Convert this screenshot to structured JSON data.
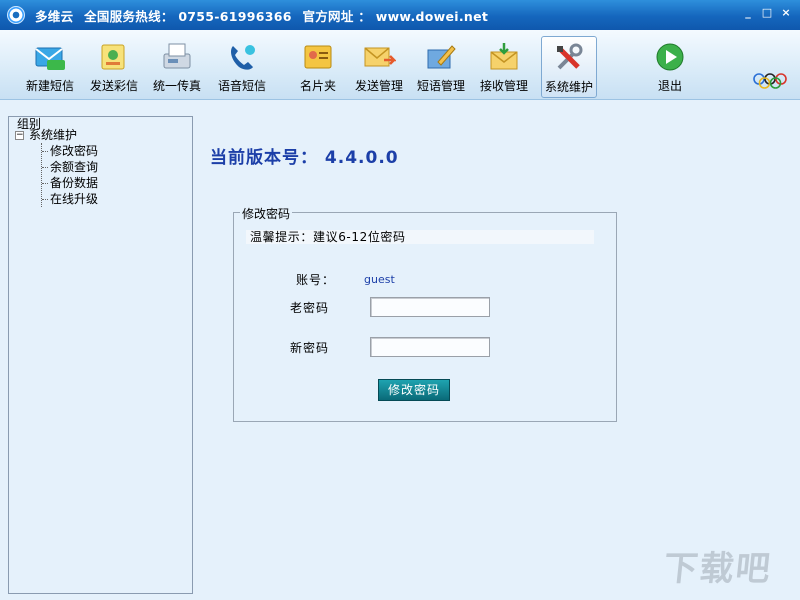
{
  "window": {
    "app_name": "多维云",
    "hotline": "全国服务热线： 0755-61996366",
    "website": "官方网址 ： www.dowei.net",
    "controls": {
      "minimize": "_",
      "maximize": "□",
      "close": "×"
    }
  },
  "toolbar": {
    "items": [
      {
        "label": "新建短信",
        "icon": "new-sms-icon"
      },
      {
        "label": "发送彩信",
        "icon": "send-mms-icon"
      },
      {
        "label": "统一传真",
        "icon": "fax-icon"
      },
      {
        "label": "语音短信",
        "icon": "voice-phone-icon"
      },
      {
        "label": "名片夹",
        "icon": "business-card-icon"
      },
      {
        "label": "发送管理",
        "icon": "send-mail-icon"
      },
      {
        "label": "短语管理",
        "icon": "phrase-edit-icon"
      },
      {
        "label": "接收管理",
        "icon": "receive-mail-icon"
      },
      {
        "label": "系统维护",
        "icon": "tools-icon"
      },
      {
        "label": "退出",
        "icon": "exit-icon"
      }
    ],
    "active": "系统维护"
  },
  "sidebar": {
    "group_label": "组别",
    "root": "系统维护",
    "children": [
      "修改密码",
      "余额查询",
      "备份数据",
      "在线升级"
    ]
  },
  "main": {
    "version_label": "当前版本号：",
    "version_value": "4.4.0.0",
    "form": {
      "legend": "修改密码",
      "tip": "温馨提示：建议6-12位密码",
      "account_label": "账号：",
      "account_value": "guest",
      "old_password_label": "老密码",
      "old_password_value": "",
      "new_password_label": "新密码",
      "new_password_value": "",
      "submit_label": "修改密码"
    }
  },
  "watermark": "下载吧",
  "colors": {
    "title_bar": "#1566bd",
    "version_text": "#1c3fa8",
    "button": "#0a6a78",
    "background": "#e5f1fb"
  }
}
